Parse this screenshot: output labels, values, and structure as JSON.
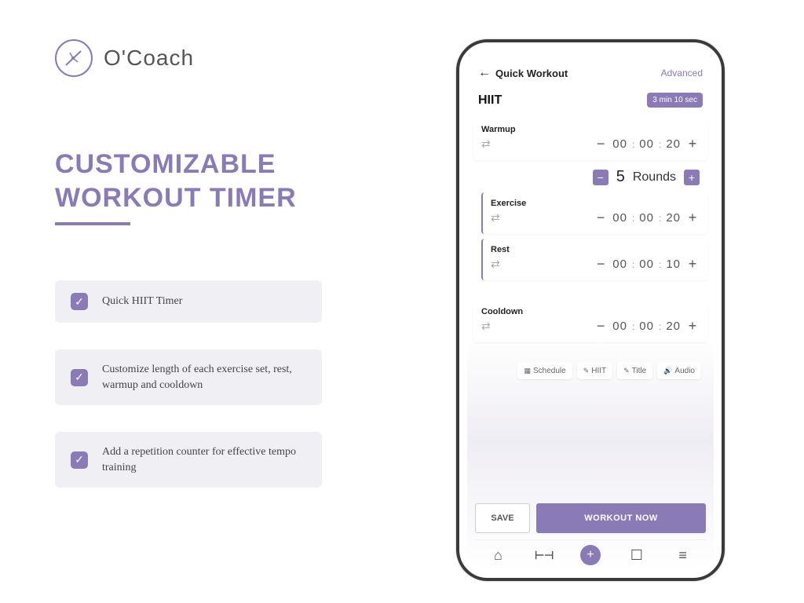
{
  "brand": {
    "name": "O'Coach"
  },
  "headline": {
    "line1": "CUSTOMIZABLE",
    "line2": "WORKOUT TIMER"
  },
  "features": [
    "Quick HIIT Timer",
    "Customize length of each exercise set, rest, warmup and cooldown",
    "Add a repetition counter for effective tempo training"
  ],
  "app": {
    "header": {
      "screen_title": "Quick Workout",
      "advanced": "Advanced"
    },
    "workout_title": "HIIT",
    "duration_badge": "3 min 10 sec",
    "rounds": {
      "count": "5",
      "label": "Rounds"
    },
    "segments": {
      "warmup": {
        "label": "Warmup",
        "hh": "00",
        "mm": "00",
        "ss": "20"
      },
      "exercise": {
        "label": "Exercise",
        "hh": "00",
        "mm": "00",
        "ss": "20"
      },
      "rest": {
        "label": "Rest",
        "hh": "00",
        "mm": "00",
        "ss": "10"
      },
      "cooldown": {
        "label": "Cooldown",
        "hh": "00",
        "mm": "00",
        "ss": "20"
      }
    },
    "chips": {
      "schedule": "Schedule",
      "hiit": "HIIT",
      "title": "Title",
      "audio": "Audio"
    },
    "buttons": {
      "save": "SAVE",
      "workout_now": "WORKOUT NOW"
    }
  }
}
